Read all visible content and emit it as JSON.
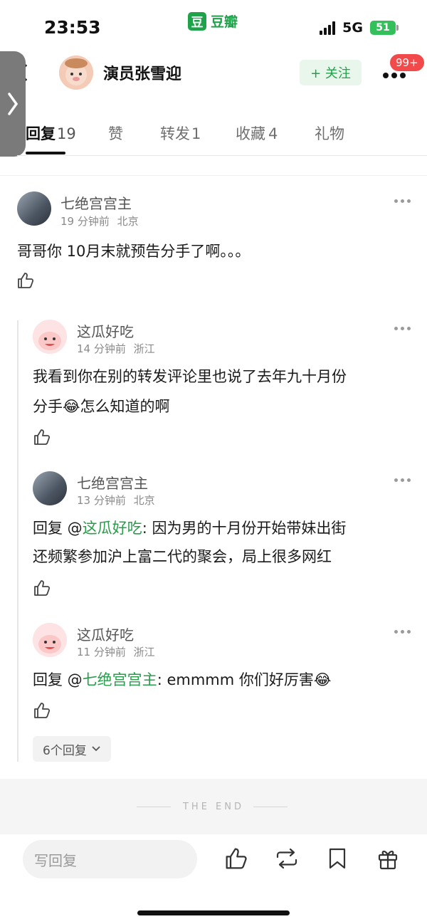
{
  "status": {
    "time": "23:53",
    "network": "5G",
    "battery": "51"
  },
  "app": {
    "logo_char": "豆",
    "name": "豆瓣"
  },
  "header": {
    "name": "演员张雪迎",
    "follow_label": "+ 关注",
    "badge": "99+"
  },
  "tabs": [
    {
      "label": "回复",
      "count": "19",
      "active": true
    },
    {
      "label": "赞",
      "count": ""
    },
    {
      "label": "转发",
      "count": "1"
    },
    {
      "label": "收藏",
      "count": "4"
    },
    {
      "label": "礼物",
      "count": ""
    }
  ],
  "comments": [
    {
      "name": "七绝宫宫主",
      "time": "19 分钟前",
      "location": "北京",
      "text": "哥哥你 10月末就预告分手了啊。。。"
    },
    {
      "name": "这瓜好吃",
      "time": "14 分钟前",
      "location": "浙江",
      "text_line1": "我看到你在别的转发评论里也说了去年九十月份",
      "text_line2_a": "分手",
      "emoji": "😂",
      "text_line2_b": "怎么知道的啊"
    },
    {
      "name": "七绝宫宫主",
      "time": "13 分钟前",
      "location": "北京",
      "reply_prefix": "回复 @",
      "mention": "这瓜好吃",
      "text_line1": ": 因为男的十月份开始带妹出街",
      "text_line2": "还频繁参加沪上富二代的聚会，局上很多网红"
    },
    {
      "name": "这瓜好吃",
      "time": "11 分钟前",
      "location": "浙江",
      "reply_prefix": "回复 @",
      "mention": "七绝宫宫主",
      "text": ": emmmm 你们好厉害",
      "emoji": "😂"
    }
  ],
  "replies_more": "6个回复",
  "end_text": "THE END",
  "bottom": {
    "input_placeholder": "写回复"
  },
  "icons": [
    "chevron-left-icon",
    "more-icon",
    "like-icon",
    "repost-icon",
    "bookmark-icon",
    "gift-icon",
    "chevron-down-icon"
  ],
  "colors": {
    "brand_green": "#1fa34a",
    "mention": "#2a9c4b",
    "badge_red": "#f24a4a"
  }
}
